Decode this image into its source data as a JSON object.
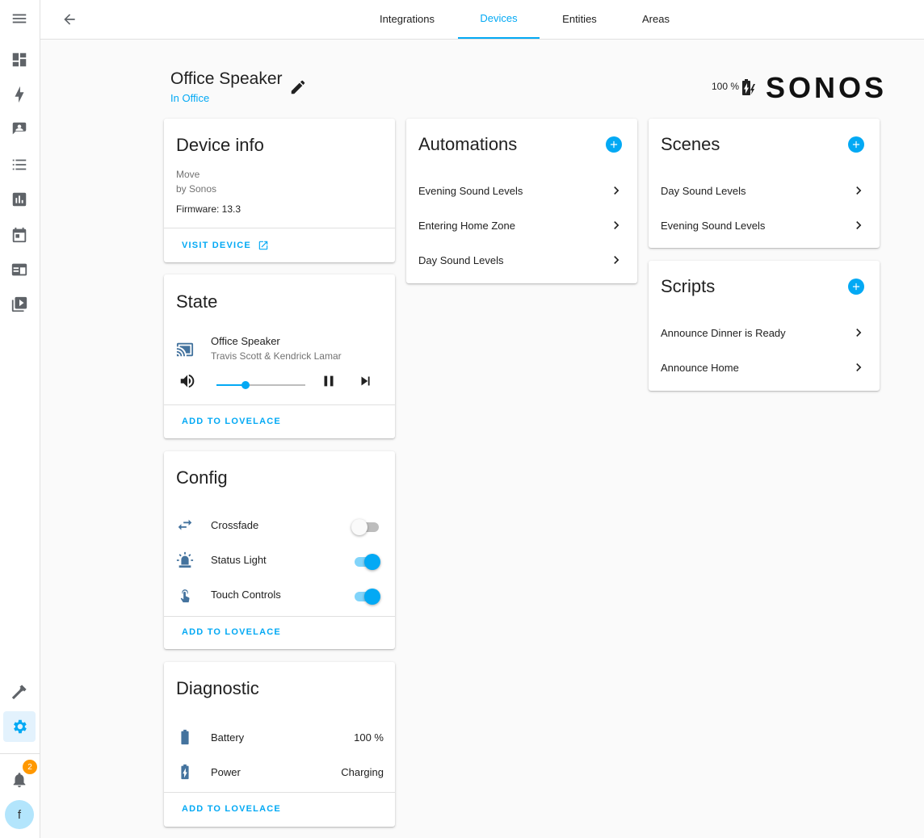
{
  "header": {
    "tabs": [
      {
        "label": "Integrations"
      },
      {
        "label": "Devices"
      },
      {
        "label": "Entities"
      },
      {
        "label": "Areas"
      }
    ],
    "active_tab": "Devices"
  },
  "sidebar": {
    "notification_count": "2",
    "user_initial": "f"
  },
  "device": {
    "name": "Office Speaker",
    "area": "In Office",
    "battery_text": "100 %",
    "brand": "SONOS"
  },
  "device_info": {
    "title": "Device info",
    "model": "Move",
    "manufacturer": "by Sonos",
    "firmware": "Firmware: 13.3",
    "visit_label": "VISIT DEVICE"
  },
  "state": {
    "title": "State",
    "entity_name": "Office Speaker",
    "media_title": "Travis Scott & Kendrick Lamar",
    "volume": 0.33,
    "add_label": "ADD TO LOVELACE"
  },
  "config": {
    "title": "Config",
    "items": [
      {
        "label": "Crossfade",
        "on": false,
        "icon": "shuffle-icon"
      },
      {
        "label": "Status Light",
        "on": true,
        "icon": "alarm-light-icon"
      },
      {
        "label": "Touch Controls",
        "on": true,
        "icon": "gesture-tap-icon"
      }
    ],
    "add_label": "ADD TO LOVELACE"
  },
  "diagnostic": {
    "title": "Diagnostic",
    "items": [
      {
        "label": "Battery",
        "value": "100 %",
        "icon": "battery-icon"
      },
      {
        "label": "Power",
        "value": "Charging",
        "icon": "battery-charging-icon"
      }
    ],
    "add_label": "ADD TO LOVELACE"
  },
  "automations": {
    "title": "Automations",
    "items": [
      {
        "label": "Evening Sound Levels"
      },
      {
        "label": "Entering Home Zone"
      },
      {
        "label": "Day Sound Levels"
      }
    ]
  },
  "scenes": {
    "title": "Scenes",
    "items": [
      {
        "label": "Day Sound Levels"
      },
      {
        "label": "Evening Sound Levels"
      }
    ]
  },
  "scripts": {
    "title": "Scripts",
    "items": [
      {
        "label": "Announce Dinner is Ready"
      },
      {
        "label": "Announce Home"
      }
    ]
  },
  "colors": {
    "accent": "#03a9f4",
    "entity_icon": "#44739e",
    "badge": "#ff9800"
  }
}
